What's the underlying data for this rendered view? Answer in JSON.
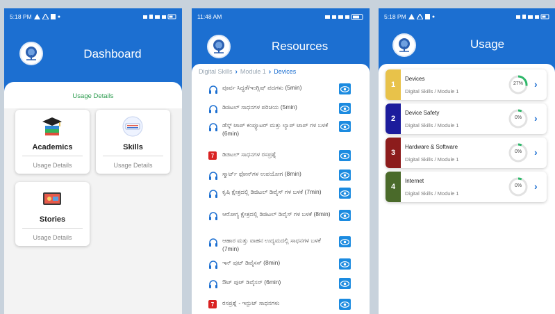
{
  "colors": {
    "header": "#1c6fd1",
    "usage_green": "#2e9c50",
    "eye_blue": "#1c8be0",
    "red_badge": "#d92323",
    "ring_green": "#2fb86a"
  },
  "dashboard": {
    "time": "5:18 PM",
    "title": "Dashboard",
    "usage_details": "Usage Details",
    "cards": [
      {
        "name": "Academics",
        "usage": "Usage Details",
        "icon": "graduation-cap-icon"
      },
      {
        "name": "Skills",
        "usage": "Usage Details",
        "icon": "digital-skills-icon"
      },
      {
        "name": "Stories",
        "usage": "Usage Details",
        "icon": "stories-icon"
      }
    ]
  },
  "resources": {
    "time": "11:48 AM",
    "title": "Resources",
    "breadcrumb": [
      "Digital Skills",
      "Module 1",
      "Devices"
    ],
    "items": [
      {
        "text": "ಪೂರ್ವ ಸಿದ್ಧತೆ/ಇಂಗ್ಲಿಷ್ ಪದಗಳು (5min)",
        "type": "audio"
      },
      {
        "text": "ಡಿಜಿಟಲ್ ಸಾಧನಗಳ ಪರಿಚಯ (5min)",
        "type": "audio"
      },
      {
        "text": "ಡೆಸ್ಕ್ ಟಾಪ್ ಕಂಪ್ಯೂಟರ್ ಮತ್ತು ಲ್ಯಾಪ್ ಟಾಪ್ ಗಳ ಬಳಕೆ (6min)",
        "type": "audio"
      },
      {
        "text": "ಡಿಜಿಟಲ್ ಸಾಧನಗಳ ರಸಪ್ರಶ್ನೆ",
        "type": "quiz"
      },
      {
        "text": "ಸ್ಮಾರ್ಟ್ ಫೋನ್‌ಗಳ ಉಪಯೋಗ (8min)",
        "type": "audio"
      },
      {
        "text": "ಕೃಷಿ ಕ್ಷೇತ್ರದಲ್ಲಿ ಡಿಜಿಟಲ್ ಡಿವೈಸ್ ಗಳ ಬಳಕೆ (7min)",
        "type": "audio"
      },
      {
        "text": "ಆರೋಗ್ಯ ಕ್ಷೇತ್ರದಲ್ಲಿ ಡಿಜಿಟಲ್ ಡಿವೈಸ್ ಗಳ ಬಳಕೆ (8min)",
        "type": "audio"
      },
      {
        "text": "ಆಹಾರ ಮತ್ತು ವಾಹನ ಉದ್ಯಮದಲ್ಲಿ ಸಾಧನಗಳ ಬಳಕೆ (7min)",
        "type": "audio"
      },
      {
        "text": "ಇನ್ ಪುಟ್ ಡಿವೈಸಸ್ (8min)",
        "type": "audio"
      },
      {
        "text": "ಔಟ್ ಪುಟ್ ಡಿವೈಸಸ್ (6min)",
        "type": "audio"
      },
      {
        "text": "ರಸಪ್ರಶ್ನೆ - ಇನ್ಪುಟ್ ಸಾಧನಗಳು",
        "type": "quiz"
      }
    ],
    "quiz_badge": "7"
  },
  "usage": {
    "time": "5:18 PM",
    "title": "Usage",
    "rows": [
      {
        "num": "1",
        "name": "Devices",
        "sub": "Digital Skills / Module 1",
        "pct": "27%",
        "value": 0.27,
        "color": "#e8c24a"
      },
      {
        "num": "2",
        "name": "Device Safety",
        "sub": "Digital Skills / Module 1",
        "pct": "0%",
        "value": 0.0,
        "color": "#1c1c9c"
      },
      {
        "num": "3",
        "name": "Hardware & Software",
        "sub": "Digital Skills / Module 1",
        "pct": "0%",
        "value": 0.0,
        "color": "#8c1c1c"
      },
      {
        "num": "4",
        "name": "Internet",
        "sub": "Digital Skills / Module 1",
        "pct": "0%",
        "value": 0.0,
        "color": "#4a6a2a"
      }
    ]
  }
}
